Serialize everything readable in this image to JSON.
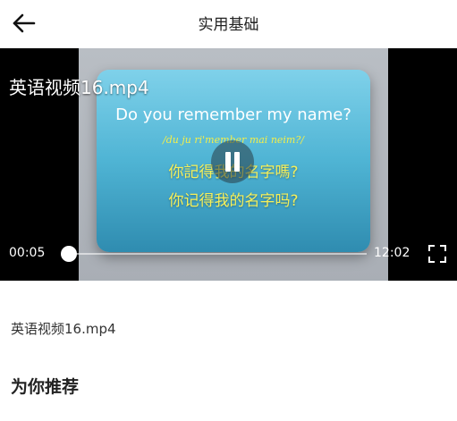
{
  "header": {
    "title": "实用基础",
    "back_icon": "back-arrow-icon"
  },
  "player": {
    "overlay_title": "英语视频16.mp4",
    "current_time": "00:05",
    "total_time": "12:02",
    "progress_fraction": 0.007,
    "state": "playing",
    "pause_icon": "pause-icon",
    "fullscreen_icon": "fullscreen-icon",
    "subtitles": {
      "english": "Do you remember my name?",
      "phonetic": "/du ju ri'member mai neim?/",
      "traditional": "你記得我的名字嗎?",
      "simplified": "你记得我的名字吗?"
    }
  },
  "content": {
    "file_name": "英语视频16.mp4",
    "recommend_heading": "为你推荐"
  },
  "colors": {
    "player_bg": "#000000",
    "subtitle_yellow": "#f6f05a",
    "card_blue": "#4fb4d4"
  }
}
